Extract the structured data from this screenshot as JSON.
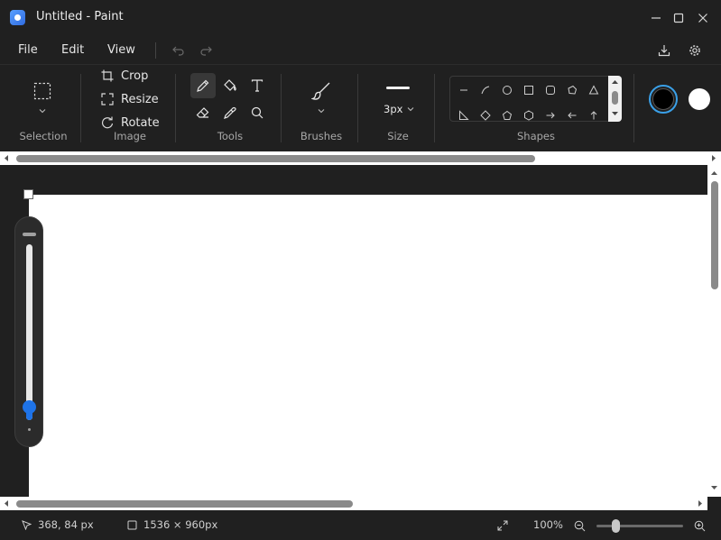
{
  "window": {
    "title": "Untitled - Paint",
    "icons": [
      "paint-app-icon",
      "minimize-icon",
      "maximize-icon",
      "close-icon"
    ]
  },
  "menu": {
    "file": "File",
    "edit": "Edit",
    "view": "View",
    "icons": [
      "undo-icon",
      "redo-icon",
      "save-icon",
      "settings-icon"
    ]
  },
  "ribbon": {
    "selection": {
      "label": "Selection",
      "icon": "rectangle-select-icon"
    },
    "image": {
      "label": "Image",
      "crop": "Crop",
      "resize": "Resize",
      "rotate": "Rotate"
    },
    "tools": {
      "label": "Tools",
      "items": [
        "pencil-icon",
        "fill-bucket-icon",
        "text-icon",
        "eraser-icon",
        "color-picker-icon",
        "magnifier-icon"
      ],
      "active": "pencil-icon"
    },
    "brushes": {
      "label": "Brushes",
      "icon": "brush-icon"
    },
    "size": {
      "label": "Size",
      "value": "3px"
    },
    "shapes": {
      "label": "Shapes",
      "row1": [
        "line",
        "curve",
        "oval",
        "rectangle",
        "rounded-rectangle",
        "polygon",
        "triangle"
      ],
      "row2": [
        "right-triangle",
        "diamond",
        "pentagon",
        "hexagon",
        "right-arrow",
        "left-arrow",
        "up-arrow"
      ]
    },
    "colors": {
      "primary": "#000000",
      "secondary": "#ffffff",
      "accent": "#3aa0e8"
    }
  },
  "canvas": {
    "background": "#ffffff",
    "brush_size_level": 0.05
  },
  "status": {
    "cursor_position": "368, 84 px",
    "canvas_size": "1536 × 960px",
    "zoom": "100%",
    "zoom_level": 0.2
  }
}
